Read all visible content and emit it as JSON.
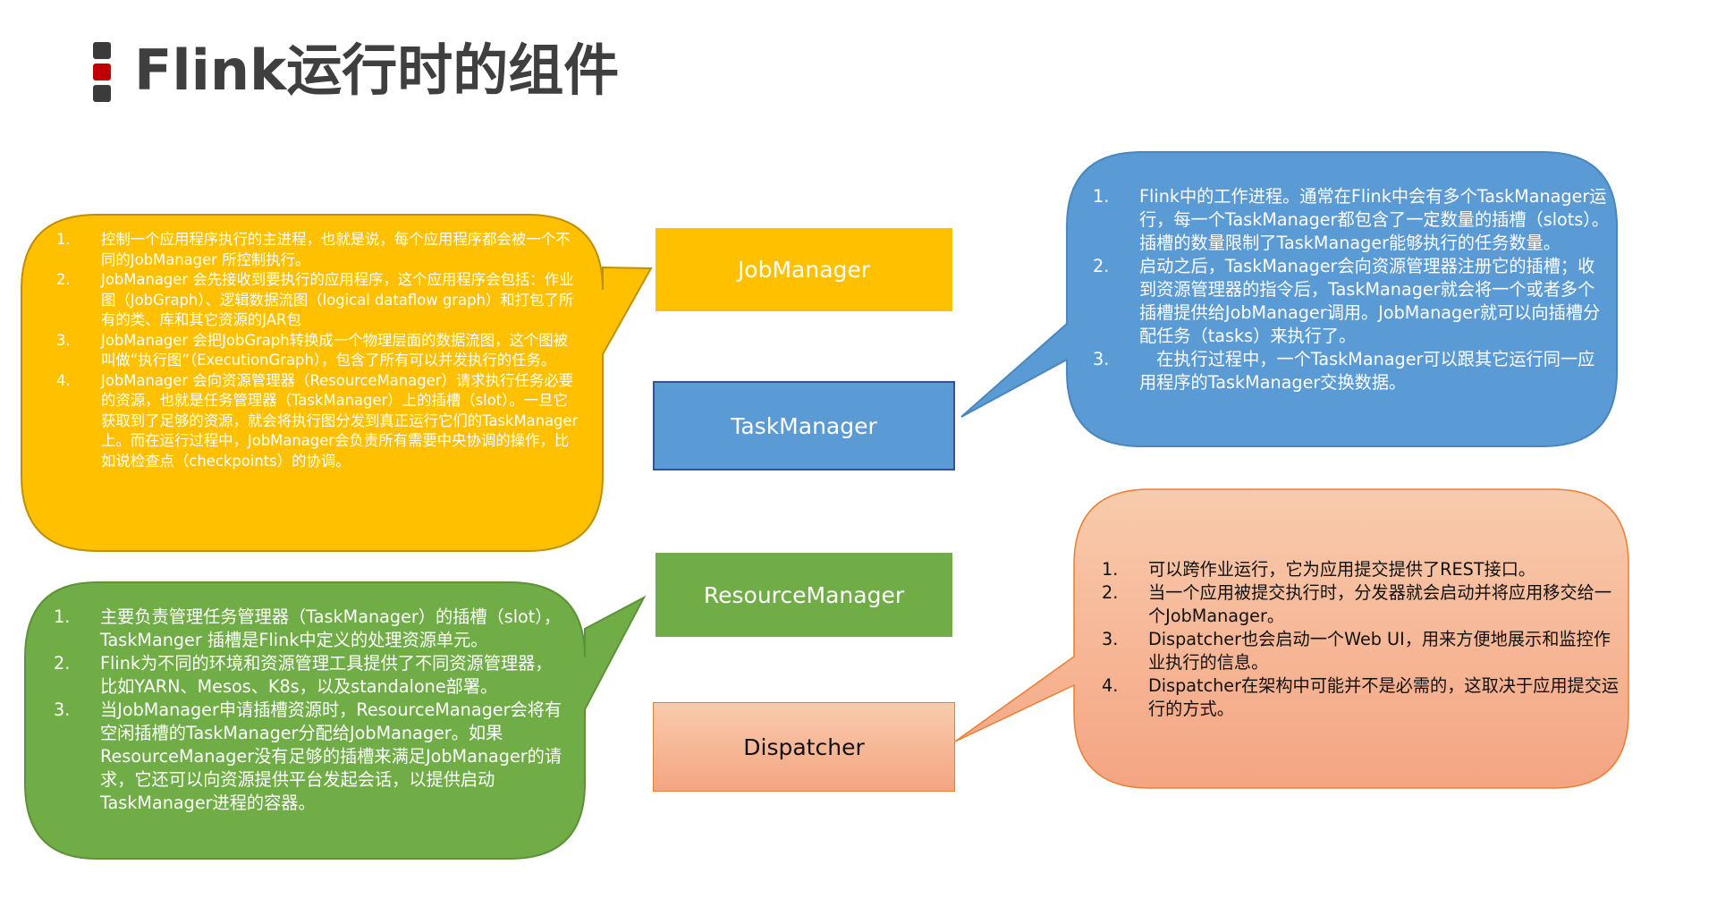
{
  "title": "Flink运行时的组件",
  "colors": {
    "job_yellow": "#FFC000",
    "task_blue": "#5B9BD5",
    "rm_green": "#70AD47",
    "disp_salmon": "#F4B183",
    "title_gray": "#3F3F3F",
    "accent_red": "#C00000"
  },
  "components": {
    "jobmanager": "JobManager",
    "taskmanager": "TaskManager",
    "resourcemanager": "ResourceManager",
    "dispatcher": "Dispatcher"
  },
  "notes": {
    "jobmanager": [
      {
        "num": "1.",
        "text": "控制一个应用程序执行的主进程，也就是说，每个应用程序都会被一个不同的JobManager 所控制执行。"
      },
      {
        "num": "2.",
        "text": "JobManager 会先接收到要执行的应用程序，这个应用程序会包括：作业图（JobGraph）、逻辑数据流图（logical dataflow graph）和打包了所有的类、库和其它资源的JAR包"
      },
      {
        "num": "3.",
        "text": "JobManager 会把JobGraph转换成一个物理层面的数据流图，这个图被叫做“执行图”（ExecutionGraph），包含了所有可以并发执行的任务。"
      },
      {
        "num": "4.",
        "text": "JobManager 会向资源管理器（ResourceManager）请求执行任务必要的资源，也就是任务管理器（TaskManager）上的插槽（slot）。一旦它获取到了足够的资源，就会将执行图分发到真正运行它们的TaskManager上。而在运行过程中，JobManager会负责所有需要中央协调的操作，比如说检查点（checkpoints）的协调。"
      }
    ],
    "taskmanager": [
      {
        "num": "1.",
        "text": "Flink中的工作进程。通常在Flink中会有多个TaskManager运行，每一个TaskManager都包含了一定数量的插槽（slots）。插槽的数量限制了TaskManager能够执行的任务数量。"
      },
      {
        "num": "2.",
        "text": "启动之后，TaskManager会向资源管理器注册它的插槽；收到资源管理器的指令后，TaskManager就会将一个或者多个插槽提供给JobManager调用。JobManager就可以向插槽分配任务（tasks）来执行了。"
      },
      {
        "num": "3.",
        "text": "　在执行过程中，一个TaskManager可以跟其它运行同一应用程序的TaskManager交换数据。"
      }
    ],
    "resourcemanager": [
      {
        "num": "1.",
        "text": "主要负责管理任务管理器（TaskManager）的插槽（slot），TaskManger 插槽是Flink中定义的处理资源单元。"
      },
      {
        "num": "2.",
        "text": "Flink为不同的环境和资源管理工具提供了不同资源管理器，比如YARN、Mesos、K8s，以及standalone部署。"
      },
      {
        "num": "3.",
        "text": "当JobManager申请插槽资源时，ResourceManager会将有空闲插槽的TaskManager分配给JobManager。如果ResourceManager没有足够的插槽来满足JobManager的请求，它还可以向资源提供平台发起会话，以提供启动TaskManager进程的容器。"
      }
    ],
    "dispatcher": [
      {
        "num": "1.",
        "text": "可以跨作业运行，它为应用提交提供了REST接口。"
      },
      {
        "num": "2.",
        "text": "当一个应用被提交执行时，分发器就会启动并将应用移交给一个JobManager。"
      },
      {
        "num": "3.",
        "text": "Dispatcher也会启动一个Web UI，用来方便地展示和监控作业执行的信息。"
      },
      {
        "num": "4.",
        "text": "Dispatcher在架构中可能并不是必需的，这取决于应用提交运行的方式。"
      }
    ]
  }
}
